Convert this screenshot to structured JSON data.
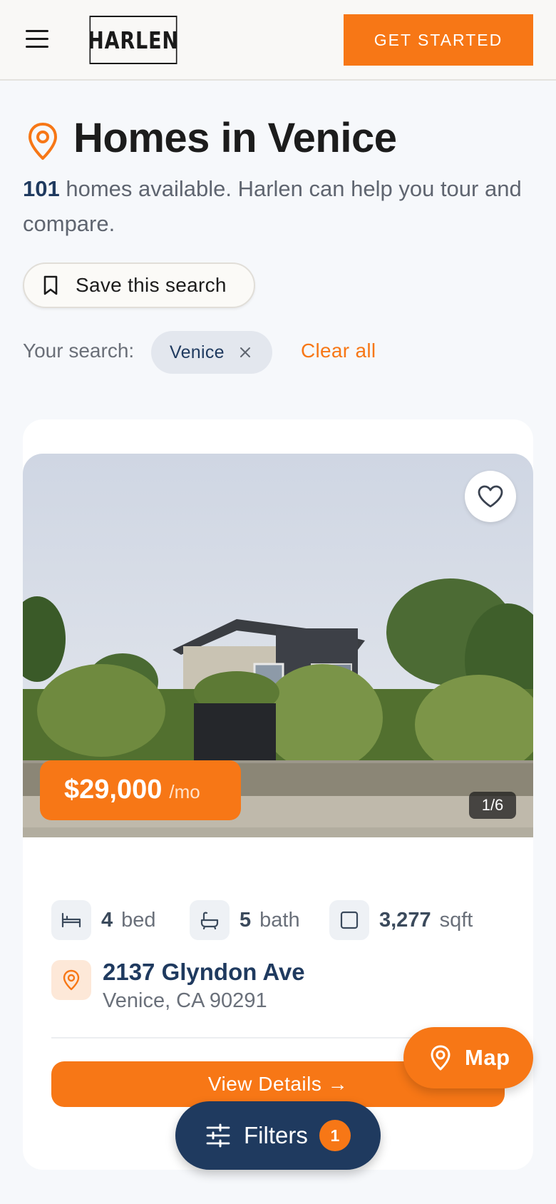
{
  "header": {
    "logo": "HARLEN",
    "cta_label": "GET STARTED"
  },
  "hero": {
    "title": "Homes in Venice",
    "count": "101",
    "subtitle_rest": " homes available. Harlen can help you tour and compare.",
    "save_label": "Save this search"
  },
  "search": {
    "label": "Your search:",
    "chips": [
      {
        "label": "Venice"
      }
    ],
    "clear_label": "Clear all"
  },
  "listing": {
    "price": "$29,000",
    "price_unit": "/mo",
    "photo_counter": "1/6",
    "beds": "4",
    "beds_unit": "bed",
    "baths": "5",
    "baths_unit": "bath",
    "sqft": "3,277",
    "sqft_unit": "sqft",
    "address_line1": "2137 Glyndon Ave",
    "address_line2": "Venice, CA 90291",
    "details_label": "View Details →"
  },
  "floating": {
    "map_label": "Map",
    "filters_label": "Filters",
    "filters_count": "1"
  },
  "colors": {
    "accent": "#f77716",
    "navy": "#1f3a5f",
    "background": "#f6f8fb"
  }
}
